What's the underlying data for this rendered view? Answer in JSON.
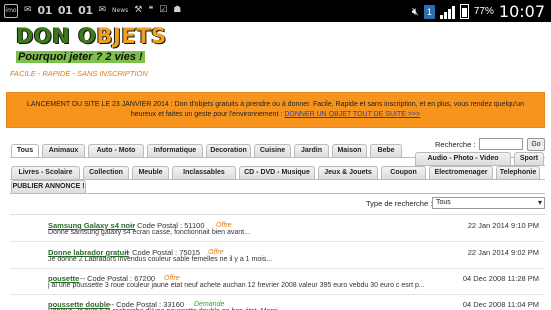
{
  "status_bar": {
    "left_icons": [
      "image-icon",
      "mail-icon",
      "binary-stream-icon",
      "binary-stream-icon",
      "binary-stream-icon",
      "mail-icon",
      "news-icon",
      "tools-icon",
      "chat-icon",
      "checkbox-icon",
      "android-icon"
    ],
    "left_labels": {
      "box": "imo",
      "binary": "01",
      "news": "News"
    },
    "network_badge": "1",
    "battery": "77%",
    "time": "10:07"
  },
  "logo": {
    "title_part1": "DON O",
    "title_part2": "BJETS",
    "subtitle": "Pourquoi jeter ? 2 vies !",
    "tagline": "FACILE - RAPIDE - SANS INSCRIPTION"
  },
  "banner": {
    "line1": "LANCEMENT DU SITE LE 23 JANVIER 2014 : Don d'objets gratuits à prendre ou à donner. Facile, Rapide et sans inscription, et en plus, vous rendez quelqu'un",
    "line2": "heureux et faites un geste pour l'environnement :",
    "link": "DONNER UN OBJET TOUT DE SUITE >>>"
  },
  "search": {
    "label": "Recherche :",
    "button": "Go",
    "value": ""
  },
  "tabs": {
    "row1": [
      "Tous",
      "Animaux",
      "Auto - Moto",
      "Informatique",
      "Decoration",
      "Cuisine",
      "Jardin",
      "Maison",
      "Bebe"
    ],
    "row1b": [
      "Audio - Photo - Video",
      "Sport"
    ],
    "row2": [
      "Livres - Scolaire",
      "Collection",
      "Meuble",
      "Inclassables",
      "CD - DVD - Musique",
      "Jeux & Jouets",
      "Coupon",
      "Electromenager",
      "Telephonie"
    ],
    "row3": [
      "PUBLIER ANNONCE !"
    ]
  },
  "filter": {
    "label": "Type de recherche :",
    "selected": "Tous"
  },
  "listings": [
    {
      "title": "Samsung Galaxy s4 noir",
      "code": "-- Code Postal : 51100",
      "type": "Offre",
      "date": "22 Jan 2014 9:10 PM",
      "desc": "Donne samsung galaxy s4 ecran casse, fonctionnait bien avant..."
    },
    {
      "title": "Donne labrador gratuit",
      "code": "-- Code Postal : 75015",
      "type": "Offre",
      "date": "22 Jan 2014 9:02 PM",
      "desc": "Je donne 2 Labradors invendus couleur sable femelles ne il y a 1 mois..."
    },
    {
      "title": "pousette",
      "code": "-- Code Postal : 67200",
      "type": "Offre",
      "date": "04 Dec 2008 11:28 PM",
      "desc": "j ai une poussette 3 roue couleur jaune etat neuf achete auchan 12 frevrier 2008 valeur 395 euro vebdu 30 euro c esrt p..."
    },
    {
      "title": "poussette double",
      "code": "-- Code Postal : 33160",
      "type": "Demande",
      "date": "04 Dec 2008 11:04 PM",
      "desc": "Bonjour, Je suis à la recherche d\\'une poussette double en bon état. Merci"
    }
  ]
}
